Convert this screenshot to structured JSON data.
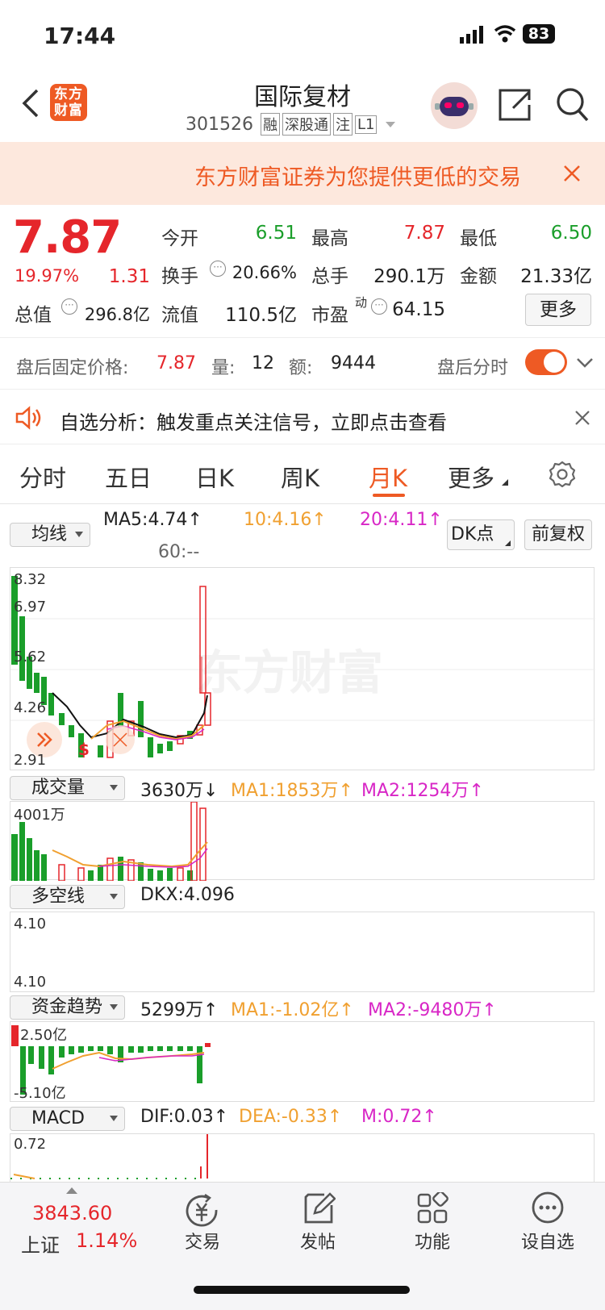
{
  "status_bar": {
    "time": "17:44",
    "battery": "83"
  },
  "header": {
    "logo_text": "东方财富",
    "stock_name": "国际复材",
    "stock_code": "301526",
    "tags": [
      "融",
      "深股通",
      "注",
      "L1"
    ]
  },
  "banner": {
    "text": "东方财富证券为您提供更低的交易"
  },
  "quote": {
    "price": "7.87",
    "change_pct": "19.97%",
    "change_amt": "1.31",
    "open_label": "今开",
    "open": "6.51",
    "high_label": "最高",
    "high": "7.87",
    "low_label": "最低",
    "low": "6.50",
    "turnover_label": "换手",
    "turnover": "20.66%",
    "volume_label": "总手",
    "volume": "290.1万",
    "amount_label": "金额",
    "amount": "21.33亿",
    "total_cap_label": "总值",
    "total_cap": "296.8亿",
    "float_cap_label": "流值",
    "float_cap": "110.5亿",
    "pe_label": "市盈",
    "pe_sup": "动",
    "pe": "64.15",
    "more_button": "更多"
  },
  "after_hours": {
    "label": "盘后固定价格:",
    "price": "7.87",
    "vol_label": "量:",
    "vol": "12",
    "amt_label": "额:",
    "amt": "9444",
    "toggle_label": "盘后分时"
  },
  "notice": {
    "text": "自选分析：触发重点关注信号，立即点击查看"
  },
  "tabs": [
    "分时",
    "五日",
    "日K",
    "周K",
    "月K",
    "更多"
  ],
  "active_tab": "月K",
  "ma": {
    "selector": "均线",
    "ma5": "MA5:4.74",
    "ma10": "10:4.16",
    "ma20": "20:4.11",
    "ma60": "60:--",
    "dk_button": "DK点",
    "fq_button": "前复权"
  },
  "kline_axis": [
    "8.32",
    "6.97",
    "5.62",
    "4.26",
    "2.91"
  ],
  "watermark": "东方财富",
  "volume_panel": {
    "selector": "成交量",
    "value": "3630万",
    "ma1": "MA1:1853万",
    "ma2": "MA2:1254万",
    "axis_top": "4001万"
  },
  "dkx_panel": {
    "selector": "多空线",
    "value": "DKX:4.096",
    "axis_top": "4.10",
    "axis_bottom": "4.10"
  },
  "fund_panel": {
    "selector": "资金趋势",
    "value": "5299万",
    "ma1": "MA1:-1.02亿",
    "ma2": "MA2:-9480万",
    "axis_top": "2.50亿",
    "axis_bottom": "-5.10亿"
  },
  "macd_panel": {
    "selector": "MACD",
    "dif": "DIF:0.03",
    "dea": "DEA:-0.33",
    "m": "M:0.72",
    "axis_top": "0.72"
  },
  "bottom_nav": {
    "index_value": "3843.60",
    "index_name": "上证",
    "index_pct": "1.14%",
    "items": [
      "交易",
      "发帖",
      "功能",
      "设自选"
    ]
  },
  "colors": {
    "up": "#e5262b",
    "down": "#1a9e2a",
    "accent": "#ee5a24"
  }
}
